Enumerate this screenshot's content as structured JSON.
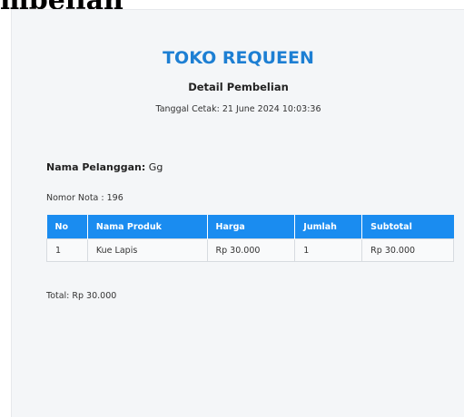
{
  "heading_cut": "mbelian",
  "store_name": "TOKO REQUEEN",
  "doc_title": "Detail Pembelian",
  "print_date": "Tanggal Cetak: 21 June 2024 10:03:36",
  "customer": {
    "label": "Nama Pelanggan:",
    "value": "Gg"
  },
  "receipt_no": "Nomor Nota : 196",
  "table": {
    "headers": [
      "No",
      "Nama Produk",
      "Harga",
      "Jumlah",
      "Subtotal"
    ],
    "rows": [
      [
        "1",
        "Kue Lapis",
        "Rp 30.000",
        "1",
        "Rp 30.000"
      ]
    ]
  },
  "total": "Total: Rp 30.000"
}
